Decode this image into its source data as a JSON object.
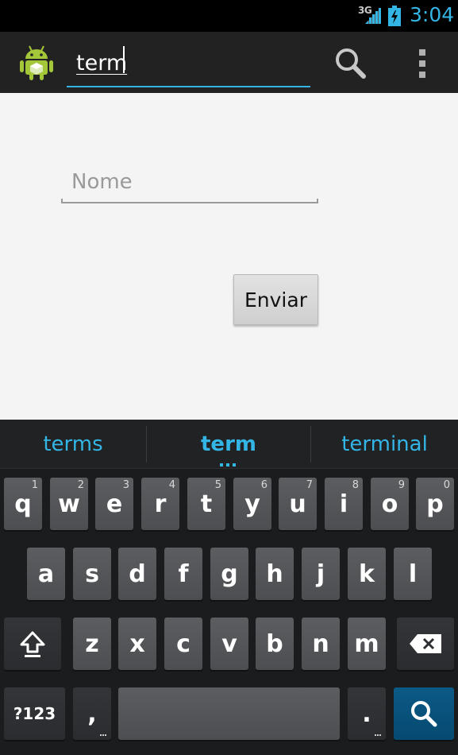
{
  "status_bar": {
    "network": "3G",
    "time": "3:04"
  },
  "action_bar": {
    "search_query": "term",
    "icons": {
      "app": "android-icon",
      "search": "search-icon",
      "overflow": "overflow-menu-icon"
    }
  },
  "form": {
    "name_placeholder": "Nome",
    "send_label": "Enviar"
  },
  "keyboard": {
    "suggestions": [
      "terms",
      "term",
      "terminal"
    ],
    "row1": [
      {
        "label": "q",
        "hint": "1"
      },
      {
        "label": "w",
        "hint": "2"
      },
      {
        "label": "e",
        "hint": "3"
      },
      {
        "label": "r",
        "hint": "4"
      },
      {
        "label": "t",
        "hint": "5"
      },
      {
        "label": "y",
        "hint": "6"
      },
      {
        "label": "u",
        "hint": "7"
      },
      {
        "label": "i",
        "hint": "8"
      },
      {
        "label": "o",
        "hint": "9"
      },
      {
        "label": "p",
        "hint": "0"
      }
    ],
    "row2": [
      "a",
      "s",
      "d",
      "f",
      "g",
      "h",
      "j",
      "k",
      "l"
    ],
    "row3": [
      "z",
      "x",
      "c",
      "v",
      "b",
      "n",
      "m"
    ],
    "symbols_label": "?123",
    "comma_label": ",",
    "period_label": ".",
    "icons": {
      "shift": "shift-icon",
      "delete": "backspace-icon",
      "search": "search-icon"
    },
    "accent_color": "#33b5e5"
  }
}
